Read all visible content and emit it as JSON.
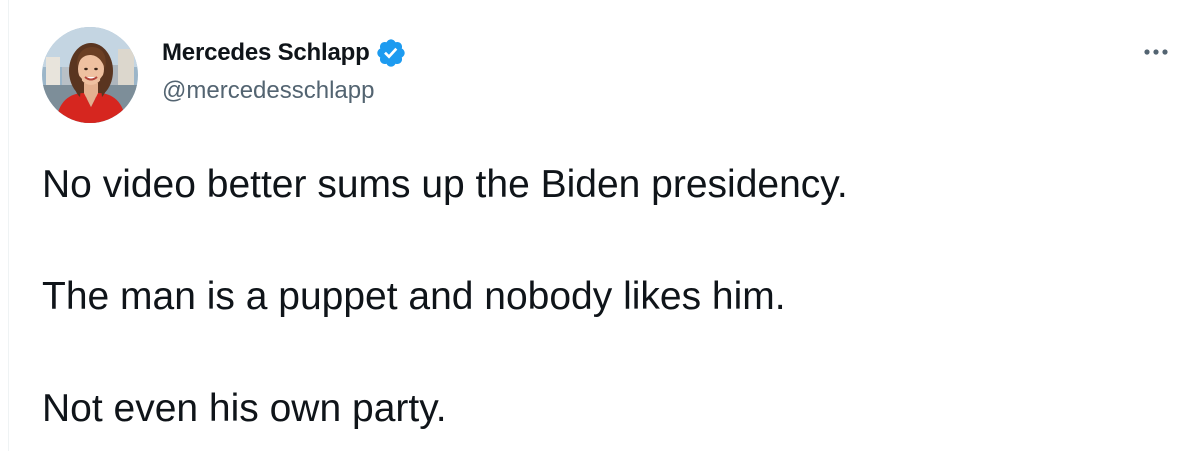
{
  "author": {
    "display_name": "Mercedes Schlapp",
    "handle": "@mercedesschlapp",
    "verified": true
  },
  "more_menu": {
    "label": "···"
  },
  "tweet": {
    "paragraphs": [
      "No video better sums up the Biden presidency.",
      "The man is a puppet and nobody likes him.",
      "Not even his own party."
    ]
  },
  "colors": {
    "verified_badge": "#1d9bf0",
    "secondary_text": "#536471",
    "primary_text": "#0f1419",
    "avatar_dress": "#d6261f"
  },
  "icons": {
    "verified": "verified-badge-icon",
    "more": "more-horizontal-icon"
  }
}
